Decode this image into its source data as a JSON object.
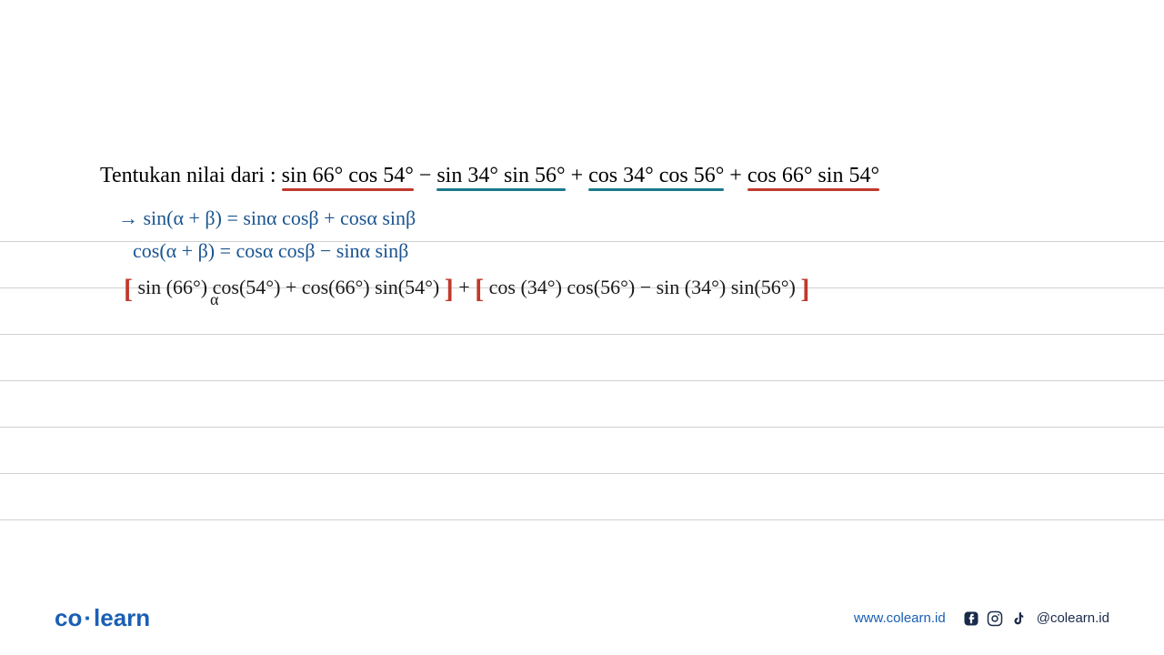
{
  "problem": {
    "label": "Tentukan nilai dari :",
    "term1": "sin 66° cos 54°",
    "op1": " − ",
    "term2": "sin 34° sin 56°",
    "op2": " + ",
    "term3": "cos 34° cos 56°",
    "op3": " + ",
    "term4": "cos 66° sin 54°"
  },
  "handwriting": {
    "line1": "→ sin(α + β) = sinα cosβ + cosα sinβ",
    "line2": "cos(α + β) = cosα cosβ − sinα sinβ",
    "line3_open": "[",
    "line3_part1": "sin (66°) cos(54°) + cos(66°) sin(54°)",
    "line3_close1": "]",
    "line3_plus": " + ",
    "line3_open2": "[",
    "line3_part2": "cos (34°) cos(56°) − sin (34°) sin(56°)",
    "line3_close2": "]",
    "strike_label": "α"
  },
  "footer": {
    "logo_co": "co",
    "logo_learn": "learn",
    "website": "www.colearn.id",
    "handle": "@colearn.id"
  }
}
